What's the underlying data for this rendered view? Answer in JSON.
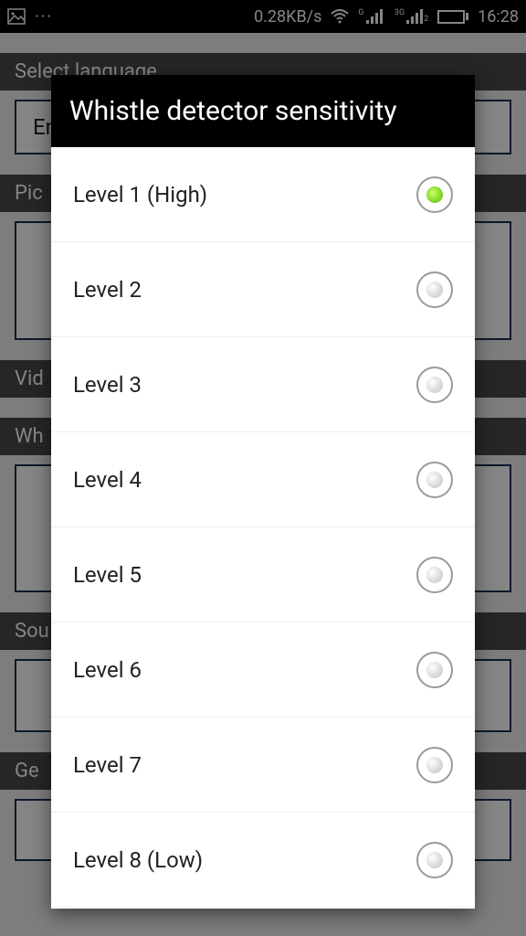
{
  "statusbar": {
    "data_rate": "0.28KB/s",
    "sig1_label": "G",
    "sig2_label": "3G",
    "sig2_sub": "2",
    "time": "16:28"
  },
  "background": {
    "sections": [
      {
        "header": "Select language",
        "value": "English"
      },
      {
        "header": "Pic",
        "value": ""
      },
      {
        "header": "Vid",
        "value": ""
      },
      {
        "header": "Wh",
        "value": ""
      },
      {
        "header": "Sou",
        "value": ""
      },
      {
        "header": "Ge",
        "value": ""
      }
    ]
  },
  "dialog": {
    "title": "Whistle detector sensitivity",
    "options": [
      {
        "label": "Level 1 (High)",
        "selected": true
      },
      {
        "label": "Level 2",
        "selected": false
      },
      {
        "label": "Level 3",
        "selected": false
      },
      {
        "label": "Level 4",
        "selected": false
      },
      {
        "label": "Level 5",
        "selected": false
      },
      {
        "label": "Level 6",
        "selected": false
      },
      {
        "label": "Level 7",
        "selected": false
      },
      {
        "label": "Level 8 (Low)",
        "selected": false
      }
    ]
  }
}
